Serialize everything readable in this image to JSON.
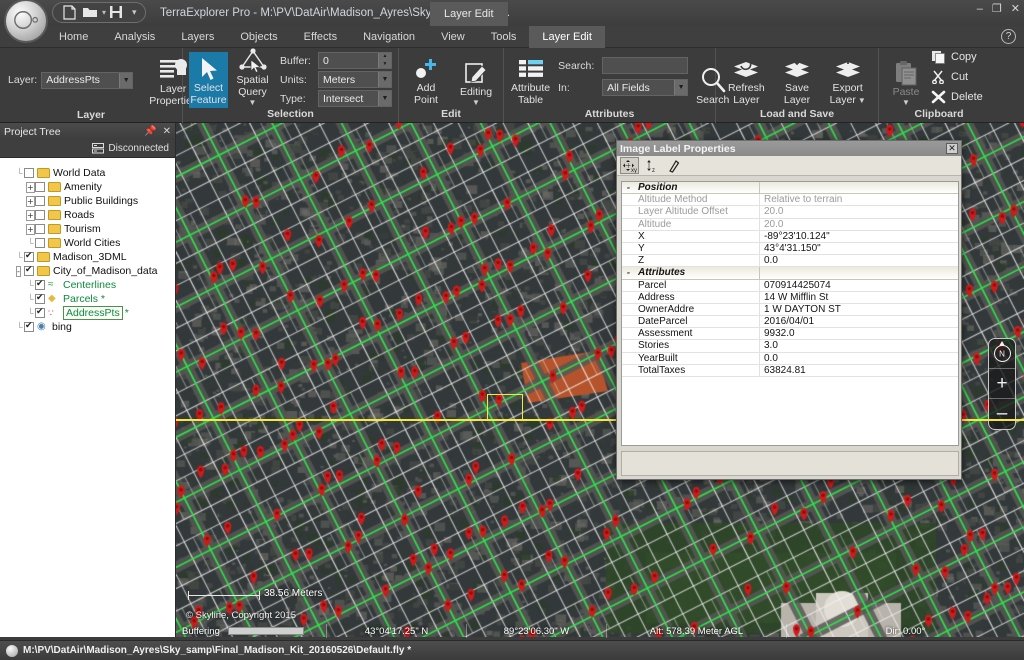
{
  "window": {
    "app_title": "TerraExplorer Pro - M:\\PV\\DatAir\\Madison_Ayres\\Sky_samp\\Final_...",
    "context_tab": "Layer Edit",
    "minimize": "–",
    "maximize": "❐",
    "close": "✕",
    "help": "?"
  },
  "quick_access": {
    "new_icon": "new-document-icon",
    "open_icon": "open-folder-icon",
    "save_icon": "save-disk-icon",
    "dropdown_icon": "chevron-down-icon",
    "customize_icon": "customize-qat-icon"
  },
  "tabs": [
    {
      "label": "Home",
      "active": false
    },
    {
      "label": "Analysis",
      "active": false
    },
    {
      "label": "Layers",
      "active": false
    },
    {
      "label": "Objects",
      "active": false
    },
    {
      "label": "Effects",
      "active": false
    },
    {
      "label": "Navigation",
      "active": false
    },
    {
      "label": "View",
      "active": false
    },
    {
      "label": "Tools",
      "active": false
    },
    {
      "label": "Layer Edit",
      "active": true
    }
  ],
  "ribbon": {
    "groups": [
      {
        "title": "Layer"
      },
      {
        "title": "Selection"
      },
      {
        "title": "Edit"
      },
      {
        "title": "Attributes"
      },
      {
        "title": "Load and Save"
      },
      {
        "title": "Clipboard"
      }
    ],
    "layer": {
      "layer_label": "Layer:",
      "layer_value": "AddressPts",
      "layer_properties": "Layer\nProperties",
      "layer_properties_l1": "Layer",
      "layer_properties_l2": "Properties"
    },
    "selection": {
      "select_feature_l1": "Select",
      "select_feature_l2": "Feature",
      "spatial_query_l1": "Spatial",
      "spatial_query_l2": "Query",
      "buffer_label": "Buffer:",
      "buffer_value": "0",
      "units_label": "Units:",
      "units_value": "Meters",
      "type_label": "Type:",
      "type_value": "Intersect"
    },
    "edit": {
      "add_point_l1": "Add",
      "add_point_l2": "Point",
      "editing_l1": "Editing"
    },
    "attributes": {
      "attribute_table_l1": "Attribute",
      "attribute_table_l2": "Table",
      "search_label": "Search:",
      "search_value": "",
      "in_label": "In:",
      "in_value": "All Fields",
      "search_button": "Search"
    },
    "load_and_save": {
      "refresh_l1": "Refresh",
      "refresh_l2": "Layer",
      "save_l1": "Save",
      "save_l2": "Layer",
      "export_l1": "Export",
      "export_l2": "Layer"
    },
    "clipboard": {
      "paste": "Paste",
      "copy": "Copy",
      "cut": "Cut",
      "delete": "Delete"
    }
  },
  "project_tree": {
    "title": "Project Tree",
    "pin_icon": "pin-icon",
    "close_icon": "close-icon",
    "connection_icon": "server-icon",
    "connection_status": "Disconnected",
    "nodes": [
      {
        "label": "World Data",
        "indent": 1,
        "checked": false,
        "expander": "",
        "icon": "folder",
        "green": false,
        "boxed": false
      },
      {
        "label": "Amenity",
        "indent": 2,
        "checked": false,
        "expander": "+",
        "icon": "folder",
        "green": false,
        "boxed": false
      },
      {
        "label": "Public Buildings",
        "indent": 2,
        "checked": false,
        "expander": "+",
        "icon": "folder",
        "green": false,
        "boxed": false
      },
      {
        "label": "Roads",
        "indent": 2,
        "checked": false,
        "expander": "+",
        "icon": "folder",
        "green": false,
        "boxed": false
      },
      {
        "label": "Tourism",
        "indent": 2,
        "checked": false,
        "expander": "+",
        "icon": "folder",
        "green": false,
        "boxed": false
      },
      {
        "label": "World Cities",
        "indent": 2,
        "checked": false,
        "expander": "",
        "icon": "folder",
        "green": false,
        "boxed": false
      },
      {
        "label": "Madison_3DML",
        "indent": 1,
        "checked": true,
        "expander": "",
        "icon": "folder",
        "green": false,
        "boxed": false
      },
      {
        "label": "City_of_Madison_data",
        "indent": 1,
        "checked": true,
        "expander": "-",
        "icon": "folder",
        "green": false,
        "boxed": false
      },
      {
        "label": "Centerlines",
        "indent": 2,
        "checked": true,
        "expander": "",
        "icon": "line",
        "green": true,
        "boxed": false
      },
      {
        "label": "Parcels *",
        "indent": 2,
        "checked": true,
        "expander": "",
        "icon": "poly",
        "green": true,
        "boxed": false
      },
      {
        "label": "AddressPts",
        "indent": 2,
        "checked": true,
        "expander": "",
        "icon": "points",
        "green": true,
        "boxed": true,
        "suffix": "*"
      },
      {
        "label": "bing",
        "indent": 1,
        "checked": true,
        "expander": "",
        "icon": "globe",
        "green": false,
        "boxed": false
      }
    ]
  },
  "dialog": {
    "title": "Image Label Properties",
    "close_icon": "close-icon",
    "tools": [
      {
        "name": "move-xy-icon",
        "pressed": true
      },
      {
        "name": "move-z-icon",
        "pressed": false
      },
      {
        "name": "pick-point-icon",
        "pressed": false
      }
    ],
    "sections": [
      {
        "name": "Position",
        "collapse": "-",
        "rows": [
          {
            "key": "Altitude Method",
            "value": "Relative to terrain",
            "dim": true
          },
          {
            "key": "Layer Altitude Offset",
            "value": "20.0",
            "dim": true
          },
          {
            "key": "Altitude",
            "value": "20.0",
            "dim": true
          },
          {
            "key": "X",
            "value": "-89°23'10.124\"",
            "dim": false
          },
          {
            "key": "Y",
            "value": "43°4'31.150\"",
            "dim": false
          },
          {
            "key": "Z",
            "value": "0.0",
            "dim": false
          }
        ]
      },
      {
        "name": "Attributes",
        "collapse": "-",
        "rows": [
          {
            "key": "Parcel",
            "value": "070914425074",
            "dim": false
          },
          {
            "key": "Address",
            "value": "14 W Mifflin St",
            "dim": false
          },
          {
            "key": "OwnerAddre",
            "value": "1 W DAYTON ST",
            "dim": false
          },
          {
            "key": "DateParcel",
            "value": "2016/04/01",
            "dim": false
          },
          {
            "key": "Assessment",
            "value": "9932.0",
            "dim": false
          },
          {
            "key": "Stories",
            "value": "3.0",
            "dim": false
          },
          {
            "key": "YearBuilt",
            "value": "0.0",
            "dim": false
          },
          {
            "key": "TotalTaxes",
            "value": "63824.81",
            "dim": false
          }
        ]
      }
    ]
  },
  "map": {
    "scale_label": "38.56 Meters",
    "copyright": "© Skyline, Copyright 2015",
    "nav": {
      "compass_icon": "compass-north-icon",
      "zoom_in": "+",
      "zoom_out": "–"
    }
  },
  "status_bar": {
    "buffering": "Buffering",
    "latitude": "43°04'17.25\" N",
    "longitude": "89°23'06.30\" W",
    "altitude": "Alt: 578.39 Meter AGL",
    "direction": "Dir: 0.00°"
  },
  "bottom_bar": {
    "project_path": "M:\\PV\\DatAir\\Madison_Ayres\\Sky_samp\\Final_Madison_Kit_20160526\\Default.fly *",
    "app_icon": "terraexplorer-logo-icon"
  },
  "colors": {
    "accent_selected": "#1b7aa8",
    "tree_layer_green": "#0c8a3d",
    "marker_red": "#d62222",
    "centerline_green": "#2ce34a",
    "selection_yellow": "#f5e93a"
  }
}
